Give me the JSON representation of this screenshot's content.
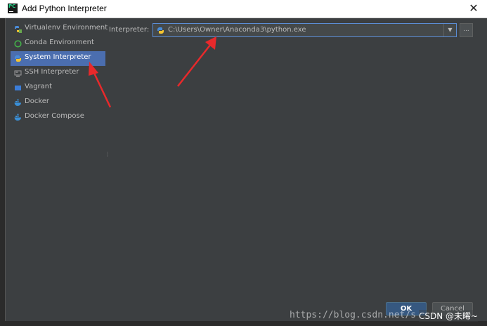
{
  "window": {
    "title": "Add Python Interpreter",
    "app_icon_text": "PC",
    "close_glyph": "✕"
  },
  "sidebar": {
    "items": [
      {
        "label": "Virtualenv Environment",
        "icon": "virtualenv-icon",
        "selected": false
      },
      {
        "label": "Conda Environment",
        "icon": "conda-icon",
        "selected": false
      },
      {
        "label": "System Interpreter",
        "icon": "python-icon",
        "selected": true
      },
      {
        "label": "SSH Interpreter",
        "icon": "ssh-icon",
        "selected": false
      },
      {
        "label": "Vagrant",
        "icon": "vagrant-icon",
        "selected": false
      },
      {
        "label": "Docker",
        "icon": "docker-icon",
        "selected": false
      },
      {
        "label": "Docker Compose",
        "icon": "docker-compose-icon",
        "selected": false
      }
    ]
  },
  "interpreter": {
    "label": "Interpreter:",
    "value": "C:\\Users\\Owner\\Anaconda3\\python.exe",
    "dropdown_glyph": "▼",
    "browse_label": "..."
  },
  "buttons": {
    "ok": "OK",
    "cancel": "Cancel"
  },
  "watermark": {
    "url": "https://blog.csdn.net/s",
    "csdn": "CSDN @未晞~"
  },
  "colors": {
    "dialog_bg": "#3c3f41",
    "selection": "#4b6eaf",
    "focus_border": "#5b8dd5",
    "annotation_arrow": "#e8292b"
  }
}
